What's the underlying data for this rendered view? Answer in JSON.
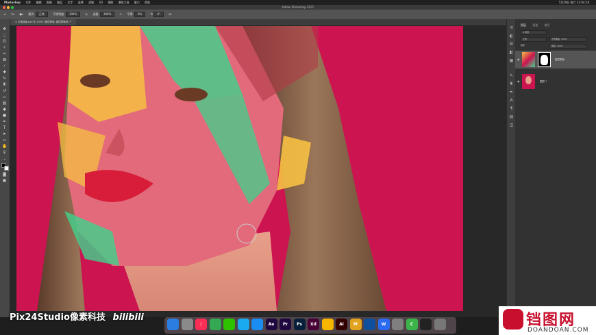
{
  "menubar": {
    "apple": "",
    "app_name": "Photoshop",
    "items": [
      "文件",
      "编辑",
      "图像",
      "图层",
      "文字",
      "选择",
      "滤镜",
      "3D",
      "视图",
      "增效工具",
      "窗口",
      "帮助"
    ],
    "clock": "5月29日 周六 22:04:18"
  },
  "window": {
    "title": "Adobe Photoshop 2021"
  },
  "options": {
    "mode_label": "模式:",
    "mode_value": "正常",
    "opacity_label": "不透明度:",
    "opacity_value": "100%",
    "flow_label": "流量:",
    "flow_value": "100%",
    "smooth_label": "平滑:",
    "smooth_value": "0%",
    "angle_value": "0°"
  },
  "document": {
    "tab_label": "打造插画.psd @ 100% (图层蒙版, 图层蒙版/8) *"
  },
  "layers_panel": {
    "tabs": [
      "图层",
      "通道",
      "路径"
    ],
    "kind_label": "Q 类型",
    "blend_mode": "正常",
    "opacity_label": "不透明度: 100%",
    "lock_label": "锁定:",
    "fill_label": "填充: 100%",
    "layers": [
      {
        "name": "图层蒙版",
        "selected": true
      },
      {
        "name": "图层 1",
        "selected": false
      }
    ]
  },
  "dock": {
    "apps": [
      {
        "name": "finder-icon",
        "label": "",
        "color": "#2a7de1"
      },
      {
        "name": "launchpad-icon",
        "label": "",
        "color": "#8a8a8a"
      },
      {
        "name": "music-icon",
        "label": "♪",
        "color": "#fa2d55"
      },
      {
        "name": "chrome-icon",
        "label": "",
        "color": "#34a853"
      },
      {
        "name": "wechat-icon",
        "label": "",
        "color": "#2dc100"
      },
      {
        "name": "qq-icon",
        "label": "",
        "color": "#1aaaf0"
      },
      {
        "name": "safari-icon",
        "label": "",
        "color": "#1b8df2"
      },
      {
        "name": "aftereffects-icon",
        "label": "Ae",
        "color": "#1f0740"
      },
      {
        "name": "premiere-icon",
        "label": "Pr",
        "color": "#1f0740"
      },
      {
        "name": "photoshop-icon",
        "label": "Ps",
        "color": "#061e3a"
      },
      {
        "name": "xd-icon",
        "label": "Xd",
        "color": "#470137"
      },
      {
        "name": "sketch-icon",
        "label": "",
        "color": "#f7b500"
      },
      {
        "name": "illustrator-icon",
        "label": "Ai",
        "color": "#300"
      },
      {
        "name": "m-app-icon",
        "label": "M",
        "color": "#e2a320"
      },
      {
        "name": "cinema4d-icon",
        "label": "",
        "color": "#0e4f9e"
      },
      {
        "name": "wps-icon",
        "label": "W",
        "color": "#2b6af3"
      },
      {
        "name": "c-app-icon",
        "label": "",
        "color": "#7f7f7f"
      },
      {
        "name": "camtasia-icon",
        "label": "C",
        "color": "#3bb54a"
      },
      {
        "name": "terminal-icon",
        "label": "",
        "color": "#222222"
      },
      {
        "name": "trash-icon",
        "label": "",
        "color": "#777777"
      }
    ]
  },
  "watermark": {
    "left_text": "Pix24Studio像素科技",
    "bilibili": "bilibili",
    "right_title": "铛图网",
    "right_sub": "DOANDOAN.COM"
  },
  "colors": {
    "canvas_bg": "#cc1450",
    "accent_green": "#3fd28c",
    "accent_yellow": "#f6c042"
  }
}
